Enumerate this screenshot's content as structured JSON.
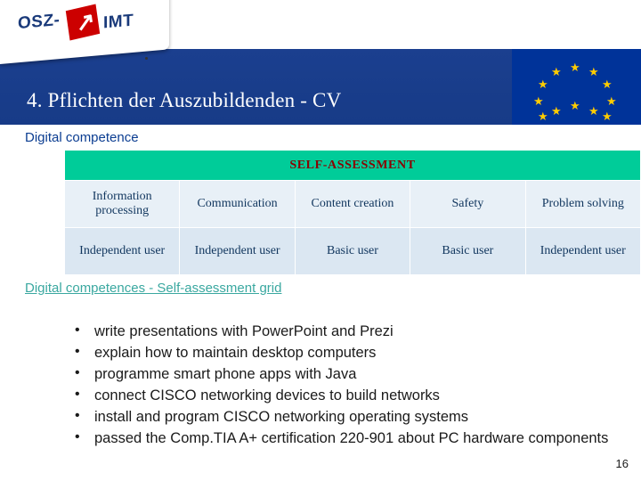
{
  "logo": {
    "text_left": "OSZ-",
    "text_right": "IMT",
    "bolt": "⚡"
  },
  "header": {
    "title": "4. Pflichten der Auszubildenden - CV"
  },
  "flag": {
    "name": "european-union-flag",
    "star": "★",
    "star_count": 12
  },
  "section": {
    "label": "Digital competence"
  },
  "table": {
    "header": "SELF-ASSESSMENT",
    "columns": [
      "Information processing",
      "Communication",
      "Content creation",
      "Safety",
      "Problem solving"
    ],
    "levels": [
      "Independent user",
      "Independent user",
      "Basic user",
      "Basic user",
      "Independent user"
    ]
  },
  "link": {
    "label": "Digital competences - Self-assessment grid"
  },
  "bullets": [
    "write presentations with PowerPoint and Prezi",
    "explain how to maintain desktop computers",
    "programme smart phone apps with Java",
    "connect CISCO networking devices to build networks",
    "install and program CISCO networking operating systems",
    "passed the Comp.TIA A+ certification 220-901 about PC hardware components"
  ],
  "footer": {
    "page_number": "16"
  },
  "colors": {
    "header_blue": "#173b87",
    "flag_blue": "#003399",
    "star_yellow": "#ffcc00",
    "table_header_green": "#00cc99",
    "table_header_text": "#8b0000",
    "link_teal": "#3aa8a0",
    "section_blue": "#0b3d91"
  }
}
